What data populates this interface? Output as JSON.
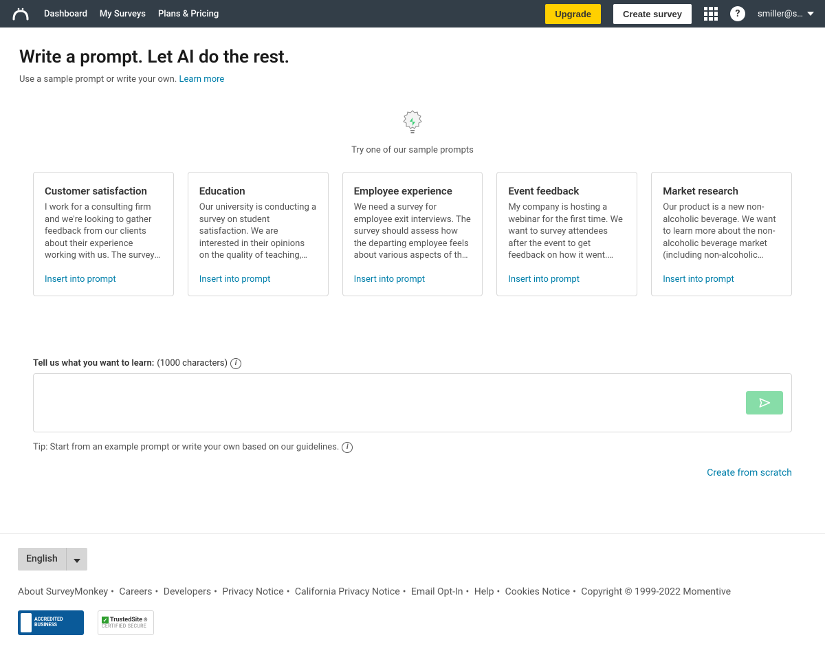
{
  "header": {
    "nav": [
      "Dashboard",
      "My Surveys",
      "Plans & Pricing"
    ],
    "upgrade": "Upgrade",
    "create": "Create survey",
    "user": "smiller@s…"
  },
  "hero": {
    "title": "Write a prompt. Let AI do the rest.",
    "subtitle_pre": "Use a sample prompt or write your own. ",
    "subtitle_link": "Learn more",
    "try_text": "Try one of our sample prompts"
  },
  "cards": [
    {
      "title": "Customer satisfaction",
      "desc": "I work for a consulting firm and we're looking to gather feedback from our clients about their experience working with us. The survey should cover customer…",
      "cta": "Insert into prompt"
    },
    {
      "title": "Education",
      "desc": "Our university is conducting a survey on student satisfaction. We are interested in their opinions on the quality of teaching, research opportunitie…",
      "cta": "Insert into prompt"
    },
    {
      "title": "Employee experience",
      "desc": "We need a survey for employee exit interviews. The survey should assess how the departing employee feels about various aspects of the company cultur…",
      "cta": "Insert into prompt"
    },
    {
      "title": "Event feedback",
      "desc": "My company is hosting a webinar for the first time. We want to survey attendees after the event to get feedback on how it went. We'd like to know their overall…",
      "cta": "Insert into prompt"
    },
    {
      "title": "Market research",
      "desc": "Our product is a new non-alcoholic beverage. We want to learn more about the non-alcoholic beverage market (including non-alcoholic wine…",
      "cta": "Insert into prompt"
    }
  ],
  "prompt": {
    "label_bold": "Tell us what you want to learn:",
    "label_chars": " (1000 characters)",
    "tip": "Tip: Start from an example prompt or write your own based on our guidelines.",
    "scratch": "Create from scratch"
  },
  "footer": {
    "language": "English",
    "links": [
      "About SurveyMonkey",
      "Careers",
      "Developers",
      "Privacy Notice",
      "California Privacy Notice",
      "Email Opt-In",
      "Help",
      "Cookies Notice"
    ],
    "copyright": "Copyright © 1999-2022 Momentive",
    "bbb_line1": "ACCREDITED",
    "bbb_line2": "BUSINESS",
    "trust_title": "TrustedSite",
    "trust_sub": "CERTIFIED SECURE"
  }
}
